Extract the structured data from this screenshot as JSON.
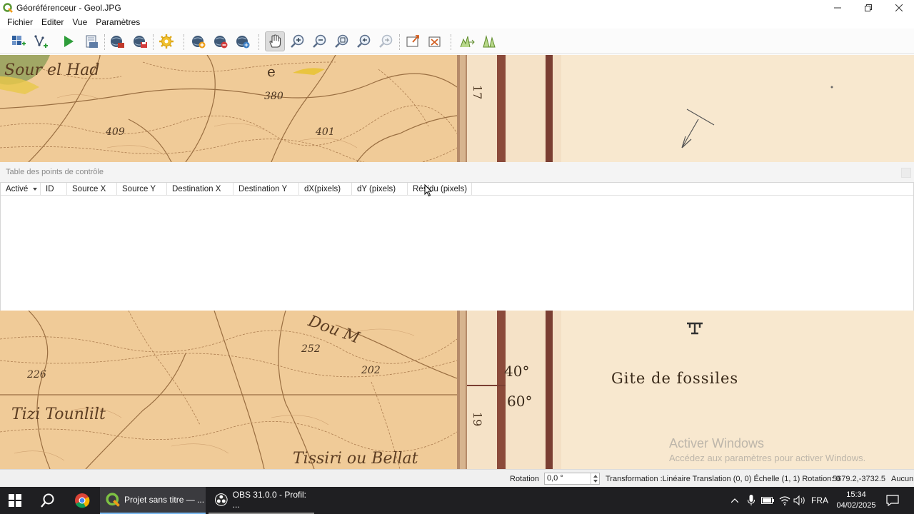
{
  "window": {
    "title": "Géoréférenceur - Geol.JPG",
    "controls": [
      "minimize",
      "restore",
      "close"
    ]
  },
  "menu": {
    "items": [
      "Fichier",
      "Editer",
      "Vue",
      "Paramètres"
    ]
  },
  "toolbar": {
    "buttons": [
      "open-raster-icon",
      "open-vector-icon",
      "start-georeferencing-icon",
      "generate-gdal-script-icon",
      "load-gcp-icon",
      "save-gcp-icon",
      "transformation-settings-icon",
      "add-point-icon",
      "delete-point-icon",
      "move-point-icon",
      "pan-icon",
      "zoom-in-icon",
      "zoom-out-icon",
      "zoom-to-layer-icon",
      "zoom-last-icon",
      "zoom-next-icon",
      "link-georef-to-qgis-icon",
      "link-qgis-to-georef-icon",
      "full-histogram-stretch-icon",
      "local-histogram-stretch-icon"
    ],
    "active": "pan-icon"
  },
  "map": {
    "labels_top": [
      "Sour el Had",
      "e",
      "380",
      "409",
      "401",
      "17"
    ],
    "labels_bottom": [
      "Dou M",
      "252",
      "202",
      "226",
      "Tizi Tounlilt",
      "Tissiri ou Bellat",
      "19",
      "40°",
      "60°",
      "Gite de fossiles"
    ]
  },
  "gcp": {
    "panel_title": "Table des points de contrôle",
    "columns": [
      "Activé",
      "ID",
      "Source X",
      "Source Y",
      "Destination X",
      "Destination Y",
      "dX(pixels)",
      "dY (pixels)",
      "Résidu (pixels)"
    ],
    "rows": []
  },
  "status": {
    "rotation_label": "Rotation",
    "rotation_value": "0,0 °",
    "transformation": "Transformation :Linéaire Translation (0, 0) Échelle (1, 1) Rotation: 0",
    "coordinates": "5679.2,-3732.5",
    "crs": "Aucun"
  },
  "watermark": {
    "line1": "Activer Windows",
    "line2": "Accédez aux paramètres pour activer Windows."
  },
  "taskbar": {
    "apps": [
      {
        "name": "Projet sans titre — ...",
        "state": "active"
      },
      {
        "name": "OBS 31.0.0 - Profil: ...",
        "state": "running"
      }
    ],
    "language": "FRA",
    "time": "15:34",
    "date": "04/02/2025"
  }
}
